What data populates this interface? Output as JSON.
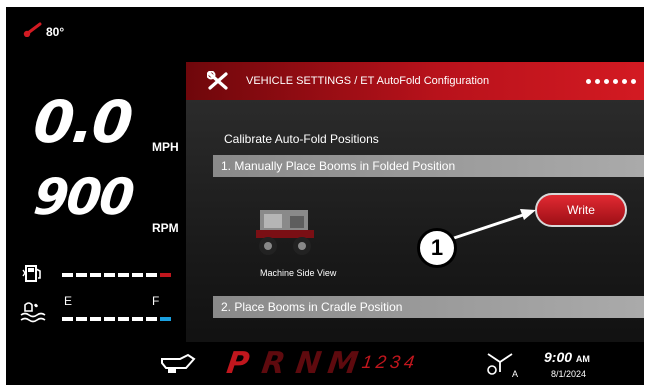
{
  "status": {
    "temperature": "80°"
  },
  "speed": {
    "value": "0.0",
    "unit": "MPH"
  },
  "engine": {
    "rpm": "900",
    "unit": "RPM"
  },
  "gauges": {
    "def_empty": "E",
    "def_full": "F"
  },
  "panel": {
    "title": "VEHICLE SETTINGS / ET AutoFold Configuration",
    "calibrate_heading": "Calibrate Auto-Fold Positions",
    "step1": "1. Manually Place Booms in Folded Position",
    "write_label": "Write",
    "machine_caption": "Machine Side View",
    "step2": "2. Place Booms in Cradle Position"
  },
  "callout": "1",
  "gear": {
    "p": "P",
    "r": "R",
    "n": "N",
    "m": "M",
    "numbers": "1234"
  },
  "clock": {
    "time": "9:00",
    "ampm": "AM",
    "date": "8/1/2024"
  },
  "colors": {
    "accent_red": "#c0161d",
    "def_blue": "#1aa0e0"
  }
}
